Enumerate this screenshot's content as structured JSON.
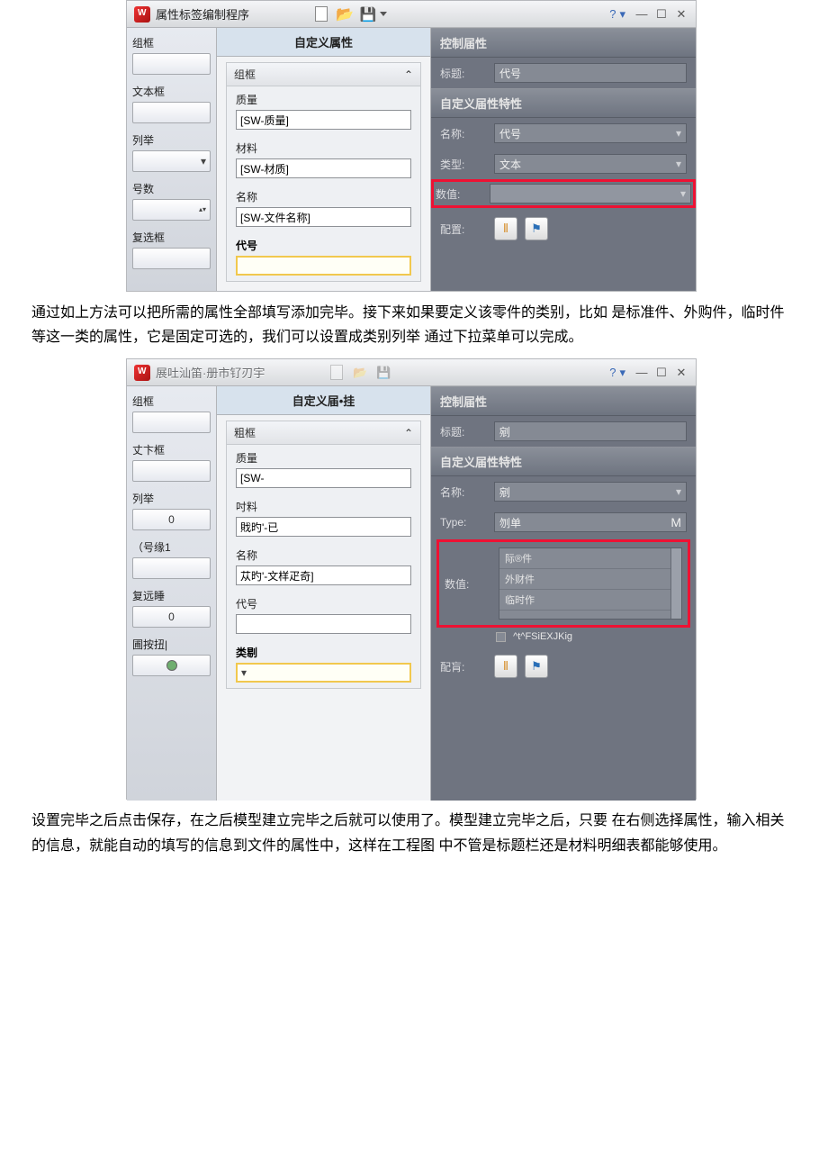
{
  "screenshot1": {
    "window_title": "属性标签编制程序",
    "help": "?",
    "palette": {
      "items": [
        {
          "label": "组框",
          "kind": "plain"
        },
        {
          "label": "文本框",
          "kind": "plain"
        },
        {
          "label": "列举",
          "kind": "dropdown"
        },
        {
          "label": "号数",
          "kind": "spinner"
        },
        {
          "label": "复选框",
          "kind": "plain"
        }
      ]
    },
    "mid_header": "自定义属性",
    "mid_group_header": "组框",
    "fields": [
      {
        "label": "质量",
        "value": "[SW-质量]",
        "sel": false
      },
      {
        "label": "材料",
        "value": "[SW-材质]",
        "sel": false
      },
      {
        "label": "名称",
        "value": "[SW-文件名称]",
        "sel": false
      },
      {
        "label": "代号",
        "value": "",
        "sel": true
      }
    ],
    "right": {
      "sec1": "控制届性",
      "title_label": "标题:",
      "title_value": "代号",
      "sec2": "自定义届性特性",
      "name_label": "名称:",
      "name_value": "代号",
      "type_label": "类型:",
      "type_value": "文本",
      "value_label": "数值:",
      "value_value": "",
      "assign_label": "配置:"
    }
  },
  "paragraph1": "通过如上方法可以把所需的属性全部填写添加完毕。接下来如果要定义该零件的类别，比如 是标准件、外购件，临时件等这一类的属性，它是固定可选的，我们可以设置成类别列举 通过下拉菜单可以完成。",
  "screenshot2": {
    "window_title": "展吐汕笛·册市钌刃宇",
    "help": "?",
    "palette": {
      "items": [
        {
          "label": "组框",
          "kind": "plain"
        },
        {
          "label": "丈卞框",
          "kind": "plain"
        },
        {
          "label": "列举",
          "kind": "num",
          "val": "0"
        },
        {
          "label": "（号缘1",
          "kind": "plain"
        },
        {
          "label": "复远睡",
          "kind": "num",
          "val": "0"
        },
        {
          "label": "圃按扭|",
          "kind": "radio"
        }
      ]
    },
    "mid_header": "自定义届•挂",
    "mid_group_header": "粗框",
    "fields": [
      {
        "label": "质量",
        "value": "[SW-",
        "sel": false
      },
      {
        "label": "吋料",
        "value": "戝旳'-已",
        "sel": false
      },
      {
        "label": "名称",
        "value": "苁旳'-文样疋奇]",
        "sel": false
      },
      {
        "label": "代号",
        "value": "",
        "sel": false
      },
      {
        "label": "类剔",
        "value": "",
        "sel": true,
        "combo": true
      }
    ],
    "right": {
      "sec1": "控制届性",
      "title_label": "标题:",
      "title_value": "剜",
      "sec2": "自定义届性特性",
      "name_label": "名称:",
      "name_value": "剜",
      "type_label": "Type:",
      "type_value": "刎单",
      "type_suffix": "M",
      "value_label": "数值:",
      "list_items": [
        "际®件",
        "外财件",
        "临时作"
      ],
      "check_text": "^t^FSiEXJKig",
      "assign_label": "配肓:"
    }
  },
  "paragraph2": "设置完毕之后点击保存，在之后模型建立完毕之后就可以使用了。模型建立完毕之后，只要 在右侧选择属性，输入相关的信息，就能自动的填写的信息到文件的属性中，这样在工程图 中不管是标题栏还是材料明细表都能够使用。"
}
